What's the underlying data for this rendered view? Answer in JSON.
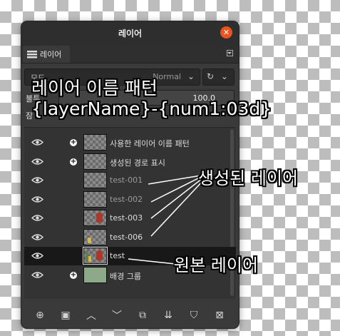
{
  "window": {
    "title": "레이어",
    "close_icon": "close-icon",
    "tab_label": "레이어",
    "tab_icon": "layers-icon"
  },
  "controls": {
    "mode_label": "모드",
    "mode_value": "Normal",
    "opacity_label": "불투",
    "opacity_value": "100.0",
    "lock_label": "잠"
  },
  "layers": [
    {
      "name": "사용한 레이어 이름 패턴",
      "visible": true,
      "group": true,
      "thumb": "transparent",
      "dim": false,
      "selected": false
    },
    {
      "name": "생성된 경로 표시",
      "visible": true,
      "group": true,
      "thumb": "transparent",
      "dim": false,
      "selected": false
    },
    {
      "name": "test-001",
      "visible": true,
      "group": false,
      "thumb": "transparent",
      "dim": true,
      "selected": false
    },
    {
      "name": "test-002",
      "visible": true,
      "group": false,
      "thumb": "transparent",
      "dim": true,
      "selected": false
    },
    {
      "name": "test-003",
      "visible": true,
      "group": false,
      "thumb": "red-figure",
      "dim": false,
      "selected": false
    },
    {
      "name": "test-006",
      "visible": true,
      "group": false,
      "thumb": "yellow-figure",
      "dim": false,
      "selected": false
    },
    {
      "name": "test",
      "visible": true,
      "group": false,
      "thumb": "full",
      "dim": false,
      "selected": true
    },
    {
      "name": "배경 그룹",
      "visible": true,
      "group": true,
      "thumb": "green",
      "dim": false,
      "selected": false
    }
  ],
  "toolbar": [
    {
      "icon": "new-layer-icon",
      "glyph": "⊕"
    },
    {
      "icon": "new-group-icon",
      "glyph": "▣"
    },
    {
      "icon": "raise-layer-icon",
      "glyph": "︿"
    },
    {
      "icon": "lower-layer-icon",
      "glyph": "﹀"
    },
    {
      "icon": "duplicate-layer-icon",
      "glyph": "⧉"
    },
    {
      "icon": "merge-down-icon",
      "glyph": "⇊"
    },
    {
      "icon": "add-mask-icon",
      "glyph": "⛉"
    },
    {
      "icon": "delete-layer-icon",
      "glyph": "⊠"
    }
  ],
  "annotations": {
    "pattern_title": "레이어 이름 패턴",
    "pattern_value": "{layerName}-{num1:03d}",
    "generated_label": "생성된 레이어",
    "original_label": "원본 레이어"
  },
  "colors": {
    "close_button": "#e95420",
    "panel_bg": "#3a3a3a",
    "selected_row": "#181818"
  }
}
